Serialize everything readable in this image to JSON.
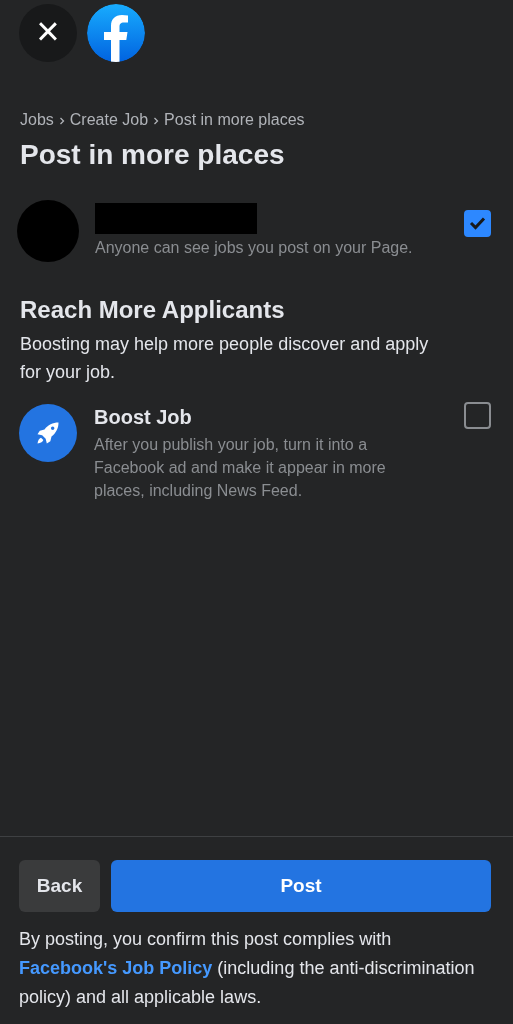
{
  "header": {
    "close_label": "×"
  },
  "breadcrumb": [
    "Jobs",
    "Create Job",
    "Post in more places"
  ],
  "title": "Post in more places",
  "page_option": {
    "description": "Anyone can see jobs you post on your Page.",
    "checked": true
  },
  "section": {
    "title": "Reach More Applicants",
    "description": "Boosting may help more people discover and apply for your job."
  },
  "boost_option": {
    "title": "Boost Job",
    "description": "After you publish your job, turn it into a Facebook ad and make it appear in more places, including News Feed.",
    "checked": false
  },
  "buttons": {
    "back": "Back",
    "post": "Post"
  },
  "footer_note": {
    "before": "By posting, you confirm this post complies with",
    "link": "Facebook's Job Policy",
    "after": "(including the anti-discrimination policy) and all applicable laws."
  }
}
